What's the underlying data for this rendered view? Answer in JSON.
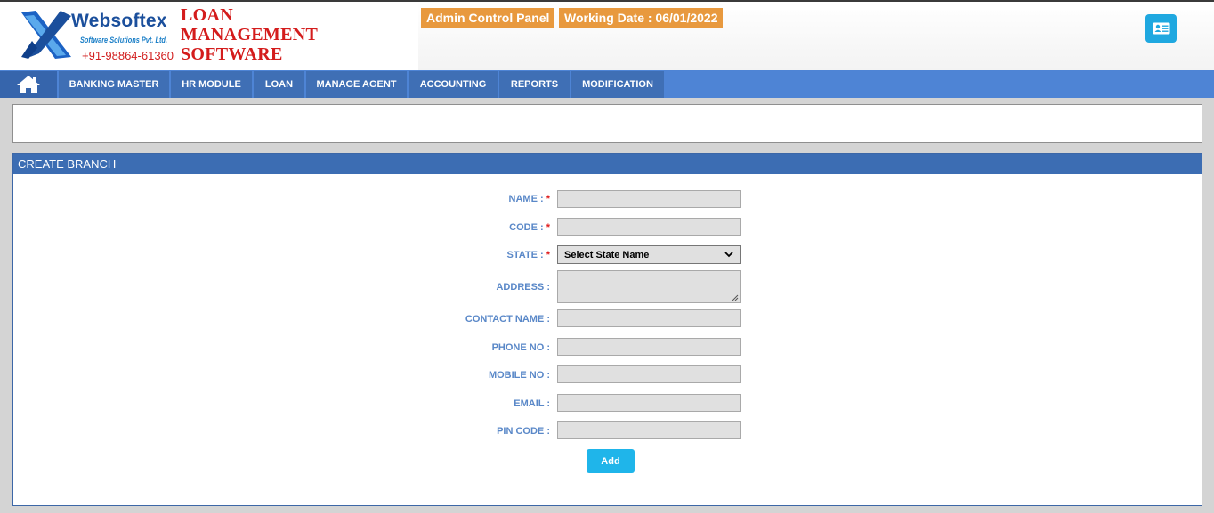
{
  "header": {
    "brand_name": "Websoftex",
    "brand_tagline": "Software Solutions Pvt. Ltd.",
    "brand_phone": "+91-98864-61360",
    "product_line1": "LOAN",
    "product_line2": "MANAGEMENT",
    "product_line3": "SOFTWARE",
    "panel_badge": "Admin Control Panel",
    "working_date": "Working Date : 06/01/2022",
    "profile_icon": "id-card-icon"
  },
  "nav": {
    "home_icon": "home-icon",
    "items": [
      "BANKING MASTER",
      "HR MODULE",
      "LOAN",
      "MANAGE AGENT",
      "ACCOUNTING",
      "REPORTS",
      "MODIFICATION"
    ]
  },
  "form": {
    "title": "CREATE BRANCH",
    "required_marker": "*",
    "fields": {
      "name": {
        "label": "NAME :",
        "value": ""
      },
      "code": {
        "label": "CODE :",
        "value": ""
      },
      "state": {
        "label": "STATE :",
        "selected": "Select State Name"
      },
      "address": {
        "label": "ADDRESS :",
        "value": ""
      },
      "contact_name": {
        "label": "CONTACT NAME :",
        "value": ""
      },
      "phone_no": {
        "label": "PHONE NO :",
        "value": ""
      },
      "mobile_no": {
        "label": "MOBILE NO :",
        "value": ""
      },
      "email": {
        "label": "EMAIL :",
        "value": ""
      },
      "pin_code": {
        "label": "PIN CODE :",
        "value": ""
      }
    },
    "submit_label": "Add"
  },
  "colors": {
    "nav_bar": "#4e84d5",
    "nav_item": "#3f6fb5",
    "badge": "#e8993e",
    "button": "#1fb5ea",
    "label": "#5a88c8",
    "required": "#e01e1e"
  }
}
